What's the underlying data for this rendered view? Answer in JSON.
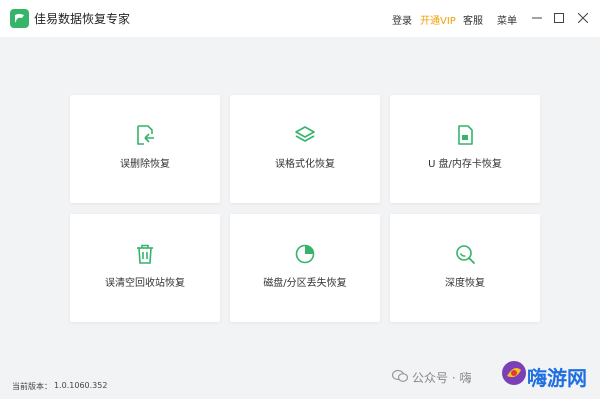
{
  "header": {
    "app_title": "佳易数据恢复专家",
    "login": "登录",
    "vip": "开通VIP",
    "service": "客服",
    "menu": "菜单"
  },
  "cards": [
    {
      "label": "误删除恢复",
      "icon": "file-restore-icon"
    },
    {
      "label": "误格式化恢复",
      "icon": "layers-icon"
    },
    {
      "label": "U 盘/内存卡恢复",
      "icon": "sd-card-icon"
    },
    {
      "label": "误清空回收站恢复",
      "icon": "trash-icon"
    },
    {
      "label": "磁盘/分区丢失恢复",
      "icon": "pie-chart-icon"
    },
    {
      "label": "深度恢复",
      "icon": "search-icon"
    }
  ],
  "status": {
    "version_label": "当前版本：",
    "version": "1.0.1060.352"
  },
  "watermark": {
    "text": "公众号 · 嗨",
    "site": "嗨游网"
  },
  "colors": {
    "accent": "#35b46a",
    "vip": "#f0a10a",
    "background": "#f2f3f5"
  }
}
